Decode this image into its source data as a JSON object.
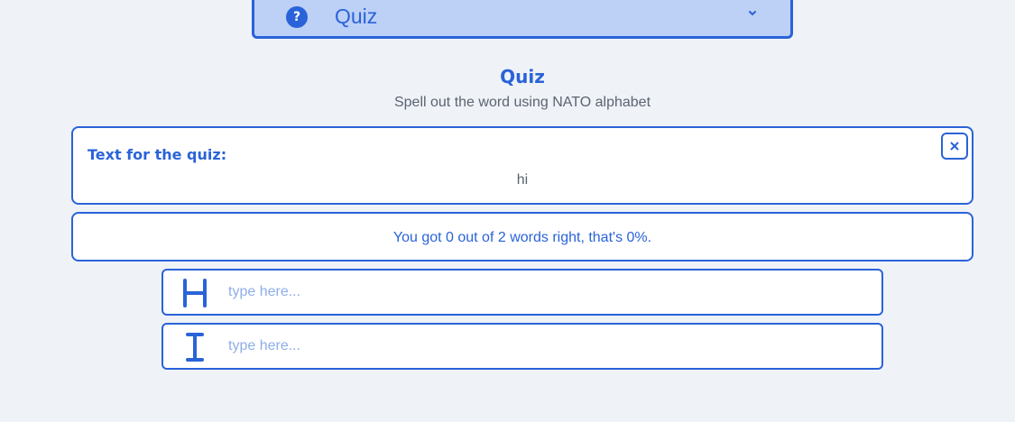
{
  "mode_select": {
    "icon": "question-circle-icon",
    "icon_glyph": "?",
    "label": "Quiz",
    "chevron": "chevron-down-icon"
  },
  "header": {
    "title": "Quiz",
    "subtitle": "Spell out the word using NATO alphabet"
  },
  "quiz_text_card": {
    "label": "Text for the quiz:",
    "text": "hi",
    "close_icon": "close-icon"
  },
  "score": {
    "text": "You got 0 out of 2 words right, that's 0%."
  },
  "answers": [
    {
      "letter": "H",
      "placeholder": "type here...",
      "value": ""
    },
    {
      "letter": "I",
      "placeholder": "type here...",
      "value": ""
    }
  ],
  "colors": {
    "accent": "#2a63d9",
    "accent_light": "#bdd0f6",
    "background": "#eff2f7",
    "card": "#ffffff",
    "text_muted": "#5b6472",
    "placeholder": "#8eaee8"
  }
}
